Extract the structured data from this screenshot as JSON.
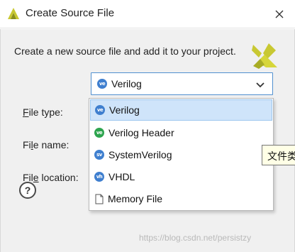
{
  "window": {
    "title": "Create Source File",
    "close_icon": "close-icon",
    "logo_icon": "vivado-logo-icon"
  },
  "description": "Create a new source file and add it to your project.",
  "fields": {
    "file_type": {
      "mnemonic": "F",
      "rest": "ile type:"
    },
    "file_name": {
      "start": "Fi",
      "mnemonic": "l",
      "rest": "e name:"
    },
    "file_location": {
      "start": "Fil",
      "mnemonic": "e",
      "rest": " location:"
    }
  },
  "file_type_select": {
    "selected": "Verilog",
    "badge": "ve",
    "chevron_icon": "chevron-down-icon"
  },
  "dropdown_options": [
    {
      "label": "Verilog",
      "badge": "ve",
      "color": "#3f7fcf",
      "selected": true
    },
    {
      "label": "Verilog Header",
      "badge": "ve",
      "color": "#2da44e",
      "selected": false
    },
    {
      "label": "SystemVerilog",
      "badge": "sv",
      "color": "#3f7fcf",
      "selected": false
    },
    {
      "label": "VHDL",
      "badge": "vh",
      "color": "#3f7fcf",
      "selected": false
    },
    {
      "label": "Memory File",
      "icon": "file-icon",
      "selected": false
    }
  ],
  "tooltip": "文件类",
  "help": {
    "label": "?",
    "icon": "help-icon"
  },
  "watermark": "https://blog.csdn.net/persistzy",
  "colors": {
    "accent": "#4f8fcf",
    "selected_row": "#cfe4fa",
    "logo_yellow": "#c8c832"
  }
}
